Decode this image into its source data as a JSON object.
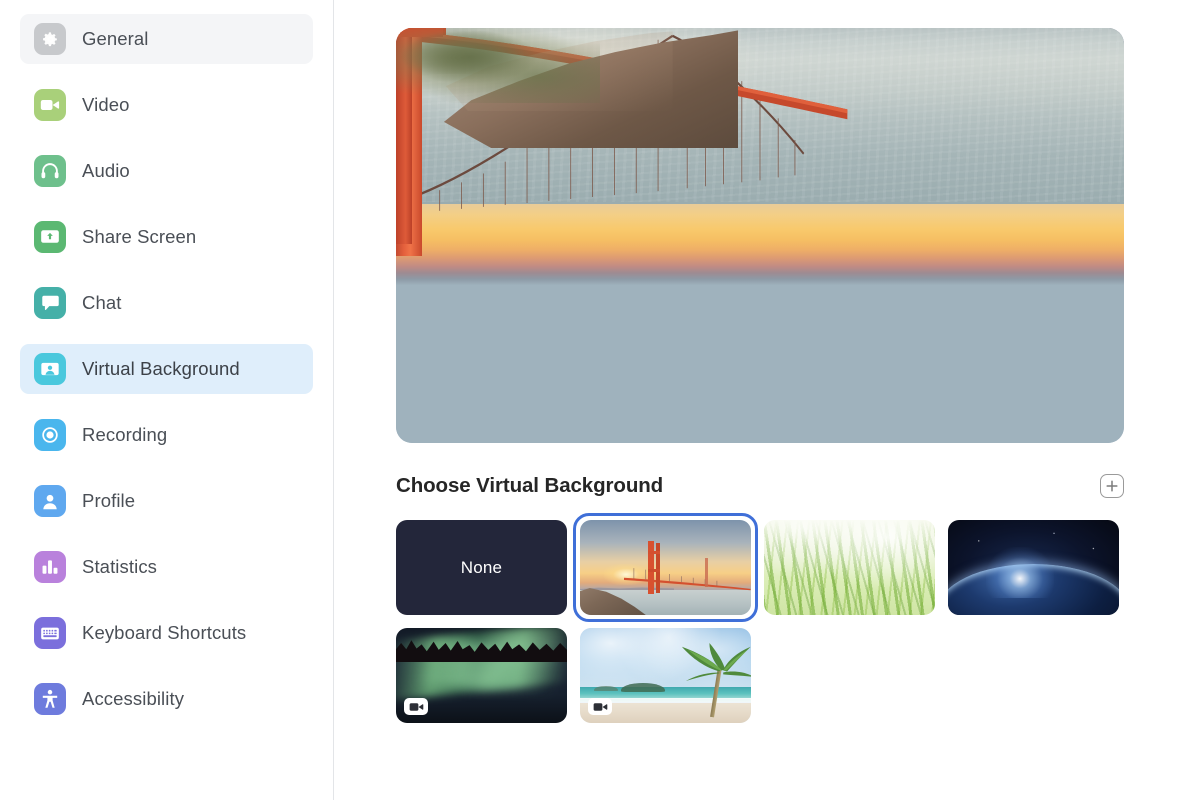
{
  "sidebar": {
    "items": [
      {
        "label": "General",
        "icon": "gear-icon",
        "state": "hover",
        "tile_color": "#c7c9cc"
      },
      {
        "label": "Video",
        "icon": "video-camera-icon",
        "state": "normal",
        "tile_color": "#a9d07a"
      },
      {
        "label": "Audio",
        "icon": "headphones-icon",
        "state": "normal",
        "tile_color": "#6ec08c"
      },
      {
        "label": "Share Screen",
        "icon": "share-screen-icon",
        "state": "normal",
        "tile_color": "#5bb872"
      },
      {
        "label": "Chat",
        "icon": "chat-bubble-icon",
        "state": "normal",
        "tile_color": "#45b0a8"
      },
      {
        "label": "Virtual Background",
        "icon": "virtual-background-icon",
        "state": "selected",
        "tile_color": "#4ac8dd"
      },
      {
        "label": "Recording",
        "icon": "record-circle-icon",
        "state": "normal",
        "tile_color": "#4ab6ed"
      },
      {
        "label": "Profile",
        "icon": "person-icon",
        "state": "normal",
        "tile_color": "#5fa8ef"
      },
      {
        "label": "Statistics",
        "icon": "bar-chart-icon",
        "state": "normal",
        "tile_color": "#b981dc"
      },
      {
        "label": "Keyboard Shortcuts",
        "icon": "keyboard-icon",
        "state": "normal",
        "tile_color": "#7b6fdc"
      },
      {
        "label": "Accessibility",
        "icon": "accessibility-icon",
        "state": "normal",
        "tile_color": "#6e7bdd"
      }
    ]
  },
  "main": {
    "preview": {
      "name": "Golden Gate Bridge at sunset",
      "alt": "Golden Gate Bridge at sunset over the bay with a rocky headland"
    },
    "section": {
      "title": "Choose Virtual Background",
      "add_button_label": "+"
    },
    "thumbnails": [
      {
        "name": "None",
        "type": "none",
        "selected": false,
        "has_video_badge": false,
        "label": "None"
      },
      {
        "name": "Golden Gate Bridge",
        "type": "image",
        "selected": true,
        "has_video_badge": false,
        "label": ""
      },
      {
        "name": "Grass",
        "type": "image",
        "selected": false,
        "has_video_badge": false,
        "label": ""
      },
      {
        "name": "Earth from Space",
        "type": "image",
        "selected": false,
        "has_video_badge": false,
        "label": ""
      },
      {
        "name": "Aurora Borealis",
        "type": "video",
        "selected": false,
        "has_video_badge": true,
        "label": ""
      },
      {
        "name": "Tropical Beach",
        "type": "video",
        "selected": false,
        "has_video_badge": true,
        "label": ""
      }
    ]
  },
  "colors": {
    "accent_selected_border": "#3f6fd8",
    "sidebar_selected_bg": "#dfeefb",
    "sidebar_hover_bg": "#f4f5f7",
    "none_tile_bg": "#23263a",
    "text_primary": "#262626",
    "text_nav": "#4a4f56"
  }
}
